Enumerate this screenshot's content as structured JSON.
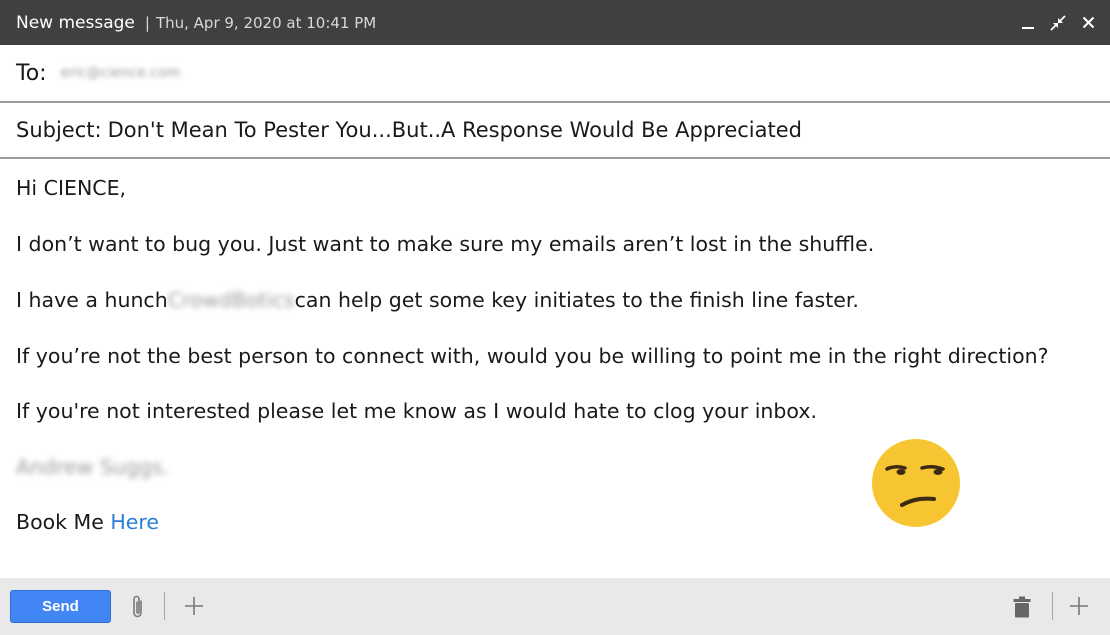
{
  "window": {
    "title": "New message",
    "separator": "|",
    "date": "Thu, Apr 9, 2020 at 10:41 PM",
    "controls": [
      "minimize-icon",
      "collapse-icon",
      "close-icon"
    ]
  },
  "to": {
    "label": "To:",
    "value": "eric@cience.com"
  },
  "subject": {
    "label": "Subject:",
    "value": "Don't Mean To Pester You...But..A Response Would Be Appreciated"
  },
  "body": {
    "greeting": "Hi CIENCE,",
    "line1": "I don’t want to bug you. Just want to make sure my emails aren’t lost in the shuffle.",
    "line2_prefix": "I have a hunch",
    "line2_redacted": "CrowdBotics",
    "line2_suffix": "can help get some key initiates to the finish line faster.",
    "line3": "If you’re not the best person to connect with, would you be willing to point me in the right direction?",
    "line4": "If you're not interested please let me know as I would hate to clog your inbox.",
    "signature": "Andrew Suggs.",
    "booking_prefix": "Book Me",
    "booking_link": "Here"
  },
  "emoji": "unamused-face-icon",
  "toolbar": {
    "send_label": "Send",
    "icons": [
      "paperclip-icon",
      "plus-icon",
      "trash-icon",
      "plus-icon"
    ]
  },
  "colors": {
    "titlebar": "#404040",
    "send_button": "#4285f4",
    "link": "#2a7ed8",
    "bottombar": "#e9e9e9",
    "emoji": "#f7c531"
  }
}
